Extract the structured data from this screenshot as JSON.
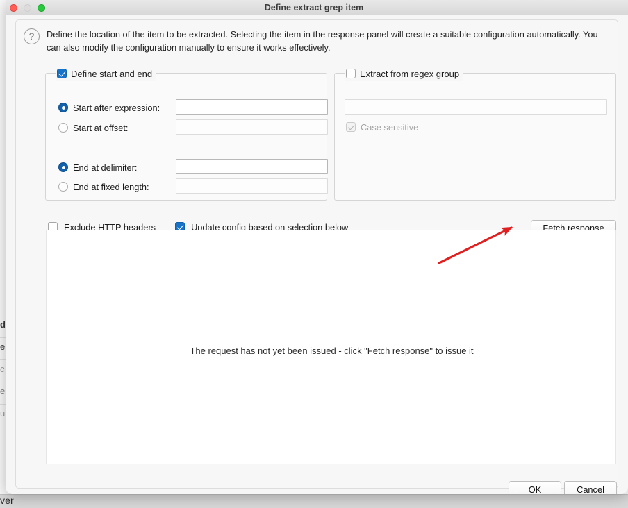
{
  "window": {
    "title": "Define extract grep item",
    "traffic_lights": [
      "close",
      "minimize",
      "maximize"
    ]
  },
  "help": {
    "icon": "question-mark-icon",
    "description": "Define the location of the item to be extracted. Selecting the item in the response panel will create a suitable configuration automatically. You can also modify the configuration manually to ensure it works effectively."
  },
  "groups": {
    "start_end": {
      "legend": "Define start and end",
      "checked": true,
      "rows": [
        {
          "label": "Start after expression:",
          "selected": true,
          "value": "",
          "enabled": true
        },
        {
          "label": "Start at offset:",
          "selected": false,
          "value": "",
          "enabled": false
        },
        {
          "label": "End at delimiter:",
          "selected": true,
          "value": "",
          "enabled": true
        },
        {
          "label": "End at fixed length:",
          "selected": false,
          "value": "",
          "enabled": false
        }
      ]
    },
    "regex": {
      "legend": "Extract from regex group",
      "checked": false,
      "pattern_value": "",
      "pattern_placeholder": "",
      "case_sensitive_label": "Case sensitive",
      "case_sensitive_checked": true,
      "case_sensitive_enabled": false
    }
  },
  "options": {
    "exclude_headers_label": "Exclude HTTP headers",
    "exclude_headers_checked": false,
    "update_config_label": "Update config based on selection below",
    "update_config_checked": true,
    "fetch_button": "Fetch response"
  },
  "response": {
    "message": "The request has not yet been issued - click \"Fetch response\" to issue it"
  },
  "footer": {
    "ok": "OK",
    "cancel": "Cancel"
  },
  "annotation": {
    "type": "arrow",
    "color": "#e02020",
    "from": [
      632,
      379
    ],
    "to": [
      741,
      325
    ],
    "points_at": "fetch-response-button"
  },
  "background": {
    "bottom_text": "ver",
    "edge_fragments": [
      "d",
      "e",
      "c",
      "e",
      "u"
    ]
  },
  "colors": {
    "accent_checkbox": "#1673c8",
    "accent_radio": "#1161ad",
    "titlebar": "#e0e0e0",
    "panel": "#f7f7f7",
    "response_panel": "#ffffff",
    "annotation_red": "#e02020"
  }
}
